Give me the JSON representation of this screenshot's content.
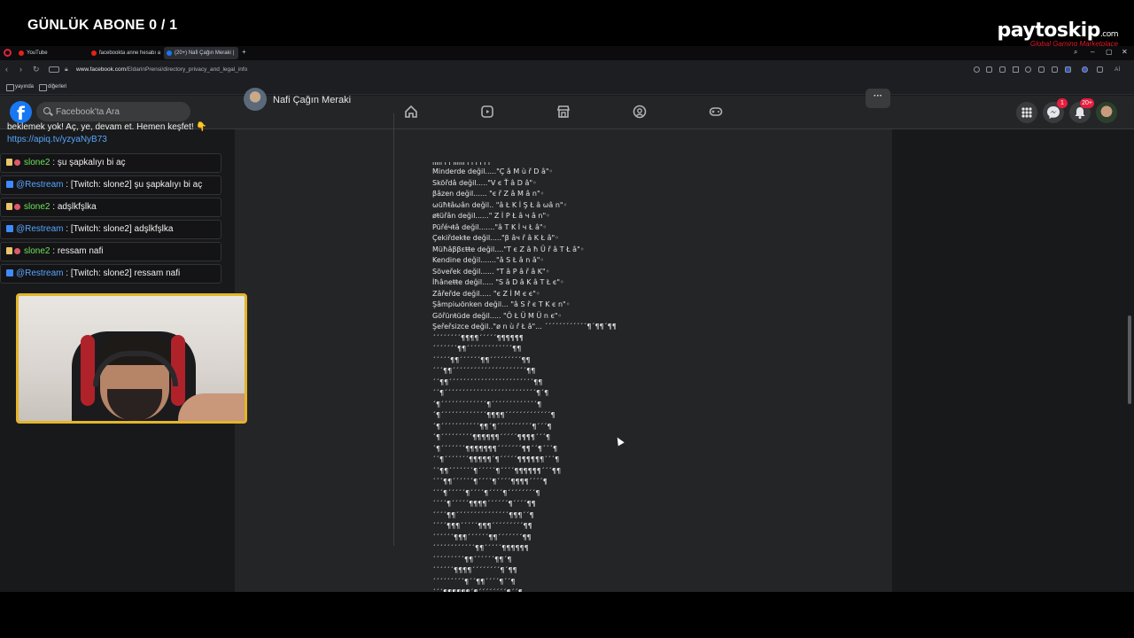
{
  "overlay": {
    "abone_counter": "GÜNLÜK ABONE 0 / 1",
    "sponsor_name": "paytoskip",
    "sponsor_suffix": ".com",
    "sponsor_tagline": "Global Gaming Marketplace"
  },
  "browser": {
    "tabs": [
      {
        "label": "YouTube",
        "color": "#e62117"
      },
      {
        "label": "facebookta anne hesabı a",
        "color": "#e62117"
      },
      {
        "label": "(20+) Nafi Çağın Meraki |",
        "color": "#1877f2",
        "active": true
      }
    ],
    "new_tab": "+",
    "url_domain": "www.facebook.com",
    "url_path": "/EldarinPrensi/directory_privacy_and_legal_info",
    "ai_label": "Aİ",
    "bookmarks": [
      "yayında",
      "diğerleri"
    ]
  },
  "facebook": {
    "logo": "f",
    "search_placeholder": "Facebook'ta Ara",
    "notifications_badge": "20+",
    "messenger_badge": "1",
    "more_label": "···"
  },
  "post": {
    "author": "Nafi Çağın Meraki",
    "lines": [
      "ıılıı ı ı ılıılı ı ı ı ı ı ı",
      "Minderde değil.....\"Ç â M ù ř D â\"◦",
      "Sköřdâ değil.....\"V є Ť â D â\"◦",
      "βâzen değil...... \"є ř Z â M â n\"◦",
      "ѡüħŧâѡân değil.. \"â Ł K İ Ş Ł â ѡâ n\"◦",
      "øŧüřân değil......\" Z İ P Ł â ч â n\"◦",
      "Püřéчŧâ değil.......\"â T K İ ч Ł â\"◦",
      "Çekiřdekŧe değil.....\"β âч ř â K Ł â\"◦",
      "Müħâββεŧŧe değil....\"T є Z â ħ Ü ř â T Ł â\"◦",
      "Kendine değil.......\"â S Ł â n â\"◦",
      "Söveřek değil...... \"T â P â ř â K\"◦",
      "İħâneŧŧe değil..... \"S â D â K â T Ł є\"◦",
      "Zâřeřde değil..... \"є Z İ M є є\"◦",
      "Şâmpiѡönken değil... \"â S ř є T K є n\"◦",
      "Göřünŧüde değil..... \"Ö Ł Ü M Ü n є\"◦",
      "Şeřeřsizce değil..\"ø n ù ř Ł â\"... ´´´´´´´´´´´´¶´¶¶´¶¶",
      "´´´´´´´´¶¶¶¶´´´´´¶¶¶¶¶¶",
      "´´´´´´´¶¶´´´´´´´´´´´´´¶¶",
      "´´´´´¶¶´´´´´´¶¶´´´´´´´´´¶¶",
      "´´´¶¶´´´´´´´´´´´´´´´´´´´´´¶¶",
      "´´¶¶´´´´´´´´´´´´´´´´´´´´´´´´¶¶",
      "´´¶´´´´´´´´´´´´´´´´´´´´´´´´´´¶´¶",
      "´¶´´´´´´´´´´´´´¶´´´´´´´´´´´´´¶",
      "´¶´´´´´´´´´´´´´¶¶¶¶´´´´´´´´´´´´´¶",
      "´¶´´´´´´´´´´´¶¶´¶´´´´´´´´´´¶´´´¶",
      "´¶´´´´´´´´´¶¶¶¶¶¶´´´´´¶¶¶¶´´´¶",
      "´¶´´´´´´´¶¶¶¶¶¶¶´´´´´´´¶¶´´¶´´´¶",
      "´´¶´´´´´´´¶¶¶¶¶´¶´´´´´¶¶¶¶¶¶´´´¶",
      "´´¶¶´´´´´´´¶´´´´´¶´´´´¶¶¶¶¶¶´´´¶¶",
      "´´´¶¶´´´´´´¶´´´´¶´´´´¶¶¶¶´´´´¶",
      "´´´¶´´´´´¶´´´´¶´´´´¶´´´´´´´´¶",
      "´´´´¶´´´´´¶¶¶¶´´´´´´¶´´´´¶¶",
      "´´´´¶¶´´´´´´´´´´´´´´´¶¶¶´´¶",
      "´´´´¶¶¶´´´´´¶¶¶´´´´´´´´´¶¶",
      "´´´´´´¶¶¶´´´´´´¶¶´´´´´´´¶¶",
      "´´´´´´´´´´´´¶¶´´´´´¶¶¶¶¶¶",
      "´´´´´´´´´¶¶´´´´´´¶¶´¶",
      "´´´´´´¶¶¶¶´´´´´´´´¶´¶¶",
      "´´´´´´´´´¶´´¶¶´´´´¶´´¶",
      "´´´¶¶¶¶¶¶´¶´´´´´´´´¶´´¶"
    ]
  },
  "chat": {
    "promo_text": "beklemek yok! Aç, ye, devam et. Hemen keşfet! 👇",
    "promo_link": "https://apiq.tv/yzyaNyB73",
    "messages": [
      {
        "kind": "user",
        "user": "slone2",
        "sep": " : ",
        "text": "şu şapkalıyı bi aç"
      },
      {
        "kind": "restream",
        "user": "@Restream",
        "sep": " : ",
        "text": "[Twitch: slone2] şu şapkalıyı bi aç"
      },
      {
        "kind": "user",
        "user": "slone2",
        "sep": " : ",
        "text": "adşlkfşlka"
      },
      {
        "kind": "restream",
        "user": "@Restream",
        "sep": " : ",
        "text": "[Twitch: slone2] adşlkfşlka"
      },
      {
        "kind": "user",
        "user": "slone2",
        "sep": " : ",
        "text": "ressam nafi"
      },
      {
        "kind": "restream",
        "user": "@Restream",
        "sep": " : ",
        "text": "[Twitch: slone2] ressam nafi"
      }
    ]
  },
  "colors": {
    "fb_blue": "#1877f2",
    "chat_user_green": "#6ee25a",
    "chat_restream_blue": "#57a6ff",
    "cam_border": "#e3b52a",
    "badge_red": "#e41e3f"
  }
}
